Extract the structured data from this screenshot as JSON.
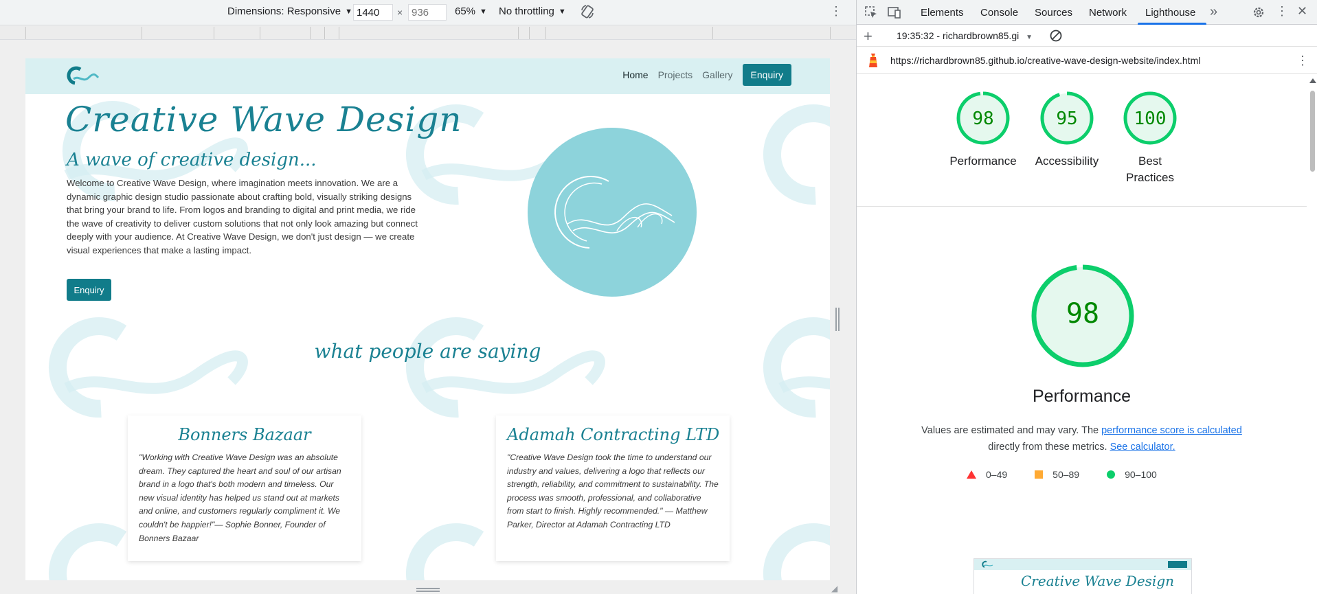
{
  "device_toolbar": {
    "dimensions_label": "Dimensions: Responsive",
    "width_value": "1440",
    "height_placeholder": "936",
    "zoom": "65%",
    "throttling": "No throttling"
  },
  "site": {
    "nav": {
      "home": "Home",
      "projects": "Projects",
      "gallery": "Gallery",
      "enquiry": "Enquiry"
    },
    "hero": {
      "title": "Creative Wave Design",
      "subtitle": "A wave of creative design...",
      "text": "Welcome to Creative Wave Design, where imagination meets innovation. We are a dynamic graphic design studio passionate about crafting bold, visually striking designs that bring your brand to life. From logos and branding to digital and print media, we ride the wave of creativity to deliver custom solutions that not only look amazing but connect deeply with your audience. At Creative Wave Design, we don't just design — we create visual experiences that make a lasting impact.",
      "button": "Enquiry"
    },
    "testimonials": {
      "heading": "what people are saying",
      "cards": [
        {
          "title": "Bonners Bazaar",
          "quote": "\"Working with Creative Wave Design was an absolute dream. They captured the heart and soul of our artisan brand in a logo that's both modern and timeless. Our new visual identity has helped us stand out at markets and online, and customers regularly compliment it. We couldn't be happier!\"— Sophie Bonner, Founder of Bonners Bazaar"
        },
        {
          "title": "Adamah Contracting LTD",
          "quote": "\"Creative Wave Design took the time to understand our industry and values, delivering a logo that reflects our strength, reliability, and commitment to sustainability. The process was smooth, professional, and collaborative from start to finish. Highly recommended.\" — Matthew Parker, Director at Adamah Contracting LTD"
        }
      ]
    },
    "colors": {
      "teal": "#117c8a",
      "title_teal": "#1a8192",
      "nav_bg": "#d9f0f2",
      "circle": "#8dd3db"
    }
  },
  "devtools": {
    "tabs": [
      "Elements",
      "Console",
      "Sources",
      "Network",
      "Lighthouse"
    ],
    "active_tab": "Lighthouse",
    "icons": [
      "inspect-icon",
      "device-toggle-icon",
      "more-tabs-icon",
      "settings-icon",
      "kebab-menu-icon",
      "close-icon"
    ],
    "report_select": "19:35:32 - richardbrown85.gi",
    "url": "https://richardbrown85.github.io/creative-wave-design-website/index.html",
    "scores": [
      {
        "label": "Performance",
        "value": 98
      },
      {
        "label": "Accessibility",
        "value": 95
      },
      {
        "label": "Best Practices",
        "value": 100
      }
    ],
    "performance": {
      "value": 98,
      "title": "Performance",
      "desc_prefix": "Values are estimated and may vary. The ",
      "desc_link": "performance score is calculated",
      "desc_middle": " directly from these metrics. ",
      "desc_link2": "See calculator."
    },
    "legend": [
      {
        "range": "0–49",
        "color": "#ff3333"
      },
      {
        "range": "50–89",
        "color": "#ffaa33"
      },
      {
        "range": "90–100",
        "color": "#0cce6b"
      }
    ],
    "thumbnail_title": "Creative Wave Design"
  }
}
